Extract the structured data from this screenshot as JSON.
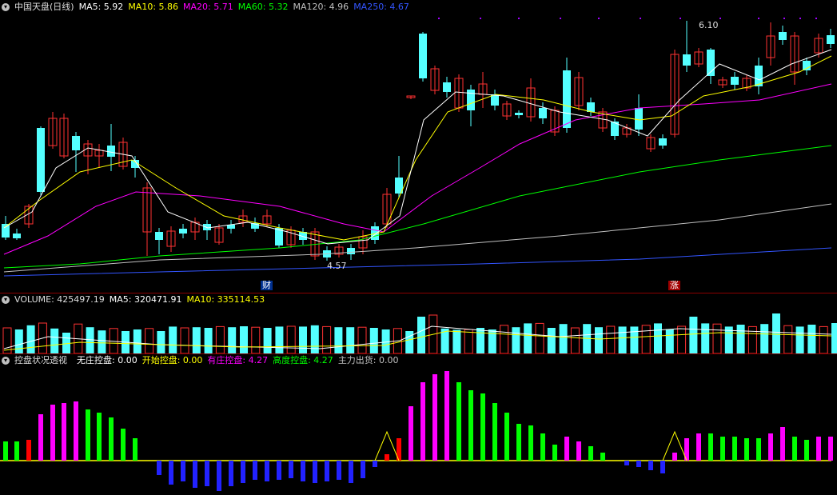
{
  "price": {
    "stock_name": "中国天盘(日线)",
    "mas": [
      {
        "label": "MA5: 5.92",
        "color": "#ffffff"
      },
      {
        "label": "MA10: 5.86",
        "color": "#ffff00"
      },
      {
        "label": "MA20: 5.71",
        "color": "#ff00ff"
      },
      {
        "label": "MA60: 5.32",
        "color": "#00ff00"
      },
      {
        "label": "MA120: 4.96",
        "color": "#c0c0c0"
      },
      {
        "label": "MA250: 4.67",
        "color": "#3355ff"
      }
    ],
    "high_label": "6.10",
    "low_label": "4.57",
    "marker_cai": "财",
    "marker_zhang": "涨"
  },
  "volume": {
    "label": "VOLUME: 425497.19",
    "ma5": "MA5: 320471.91",
    "ma10": "MA10: 335114.53"
  },
  "indicator": {
    "title": "控盘状况透视",
    "items": [
      {
        "label": "无庄控盘: 0.00",
        "color": "#ffffff"
      },
      {
        "label": "开始控盘: 0.00",
        "color": "#ffff00"
      },
      {
        "label": "有庄控盘: 4.27",
        "color": "#ff00ff"
      },
      {
        "label": "高度控盘: 4.27",
        "color": "#00ff00"
      },
      {
        "label": "主力出货: 0.00",
        "color": "#c0c0c0"
      }
    ]
  },
  "colors": {
    "up": "#ff3232",
    "down": "#54ffff",
    "blue": "#2222ff",
    "green": "#00ff00",
    "magenta": "#ff00ff",
    "yellow": "#ffff00",
    "red": "#ff0000"
  }
}
